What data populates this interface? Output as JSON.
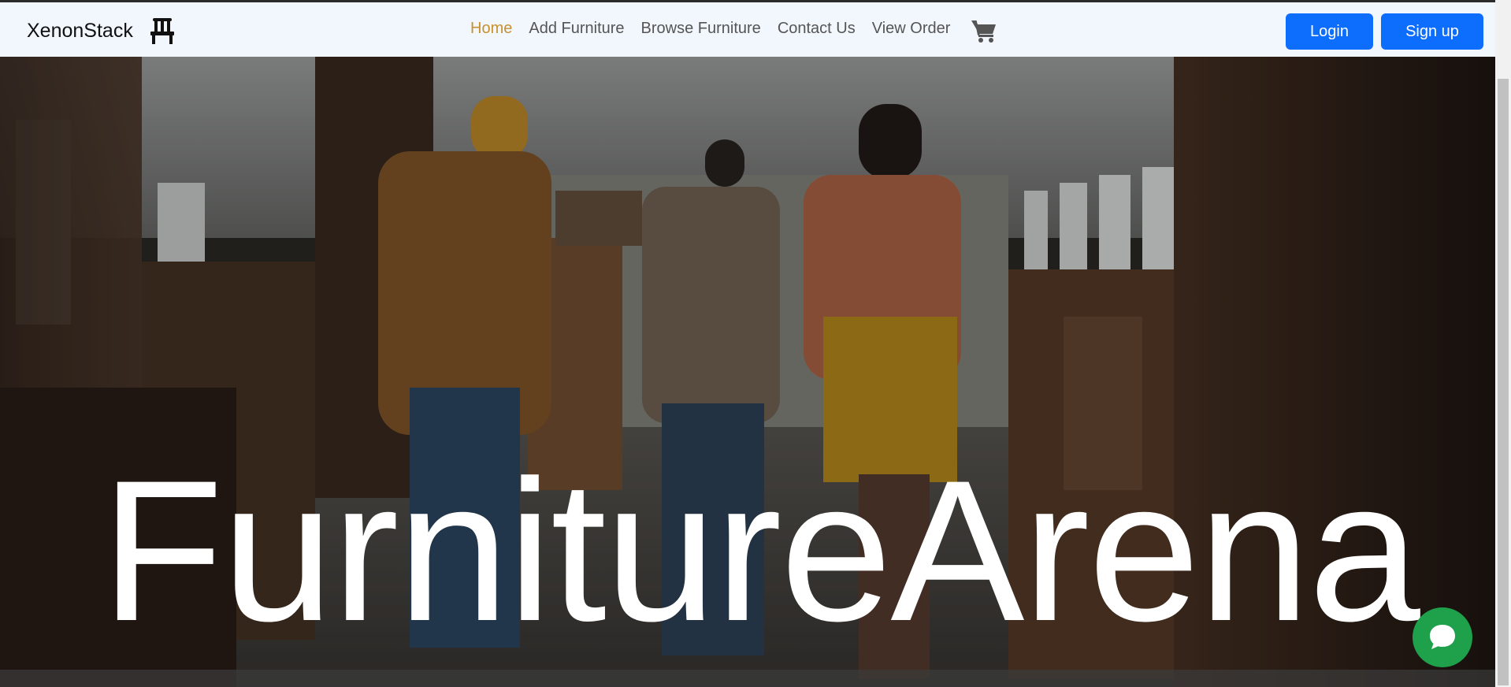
{
  "brand": {
    "name": "XenonStack",
    "icon": "chair-icon"
  },
  "nav": {
    "links": [
      {
        "label": "Home",
        "active": true
      },
      {
        "label": "Add Furniture",
        "active": false
      },
      {
        "label": "Browse Furniture",
        "active": false
      },
      {
        "label": "Contact Us",
        "active": false
      },
      {
        "label": "View Order",
        "active": false
      }
    ],
    "cart_icon": "shopping-cart-icon",
    "login_label": "Login",
    "signup_label": "Sign up"
  },
  "hero": {
    "title": "FurnitureArena"
  },
  "chat": {
    "icon": "chat-bubble-icon"
  },
  "colors": {
    "navbar_bg": "#f1f7fd",
    "primary": "#0d6efd",
    "active_link": "#c8912f",
    "chat_green": "#1fa04a"
  }
}
